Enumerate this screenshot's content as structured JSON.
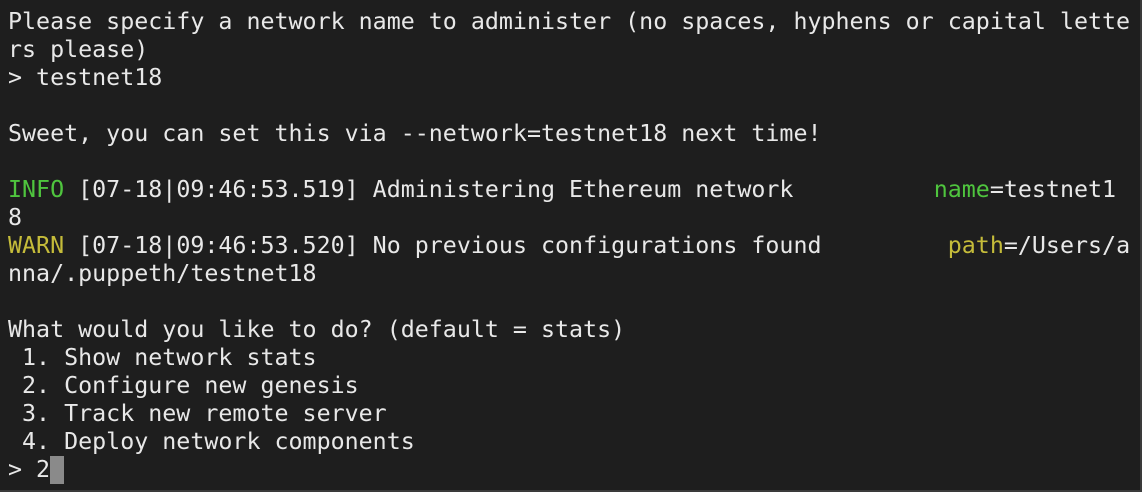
{
  "terminal": {
    "prompt_network_1": "Please specify a network name to administer (no spaces, hyphens or capital lette",
    "prompt_network_2": "rs please)",
    "input_network": "> testnet18",
    "sweet_msg": "Sweet, you can set this via --network=testnet18 next time!",
    "log_info": {
      "level": "INFO",
      "message": " [07-18|09:46:53.519] Administering Ethereum network          ",
      "key": "name",
      "value_part1": "=testnet1",
      "value_part2": "8"
    },
    "log_warn": {
      "level": "WARN",
      "message": " [07-18|09:46:53.520] No previous configurations found         ",
      "key": "path",
      "value_part1": "=/Users/a",
      "value_part2": "nna/.puppeth/testnet18"
    },
    "question": "What would you like to do? (default = stats)",
    "options": [
      " 1. Show network stats",
      " 2. Configure new genesis",
      " 3. Track new remote server",
      " 4. Deploy network components"
    ],
    "current_input": "> 2"
  },
  "colors": {
    "background": "#1e1e1e",
    "text": "#e8e8e8",
    "info": "#4fc53e",
    "warn": "#c5bc3a"
  }
}
